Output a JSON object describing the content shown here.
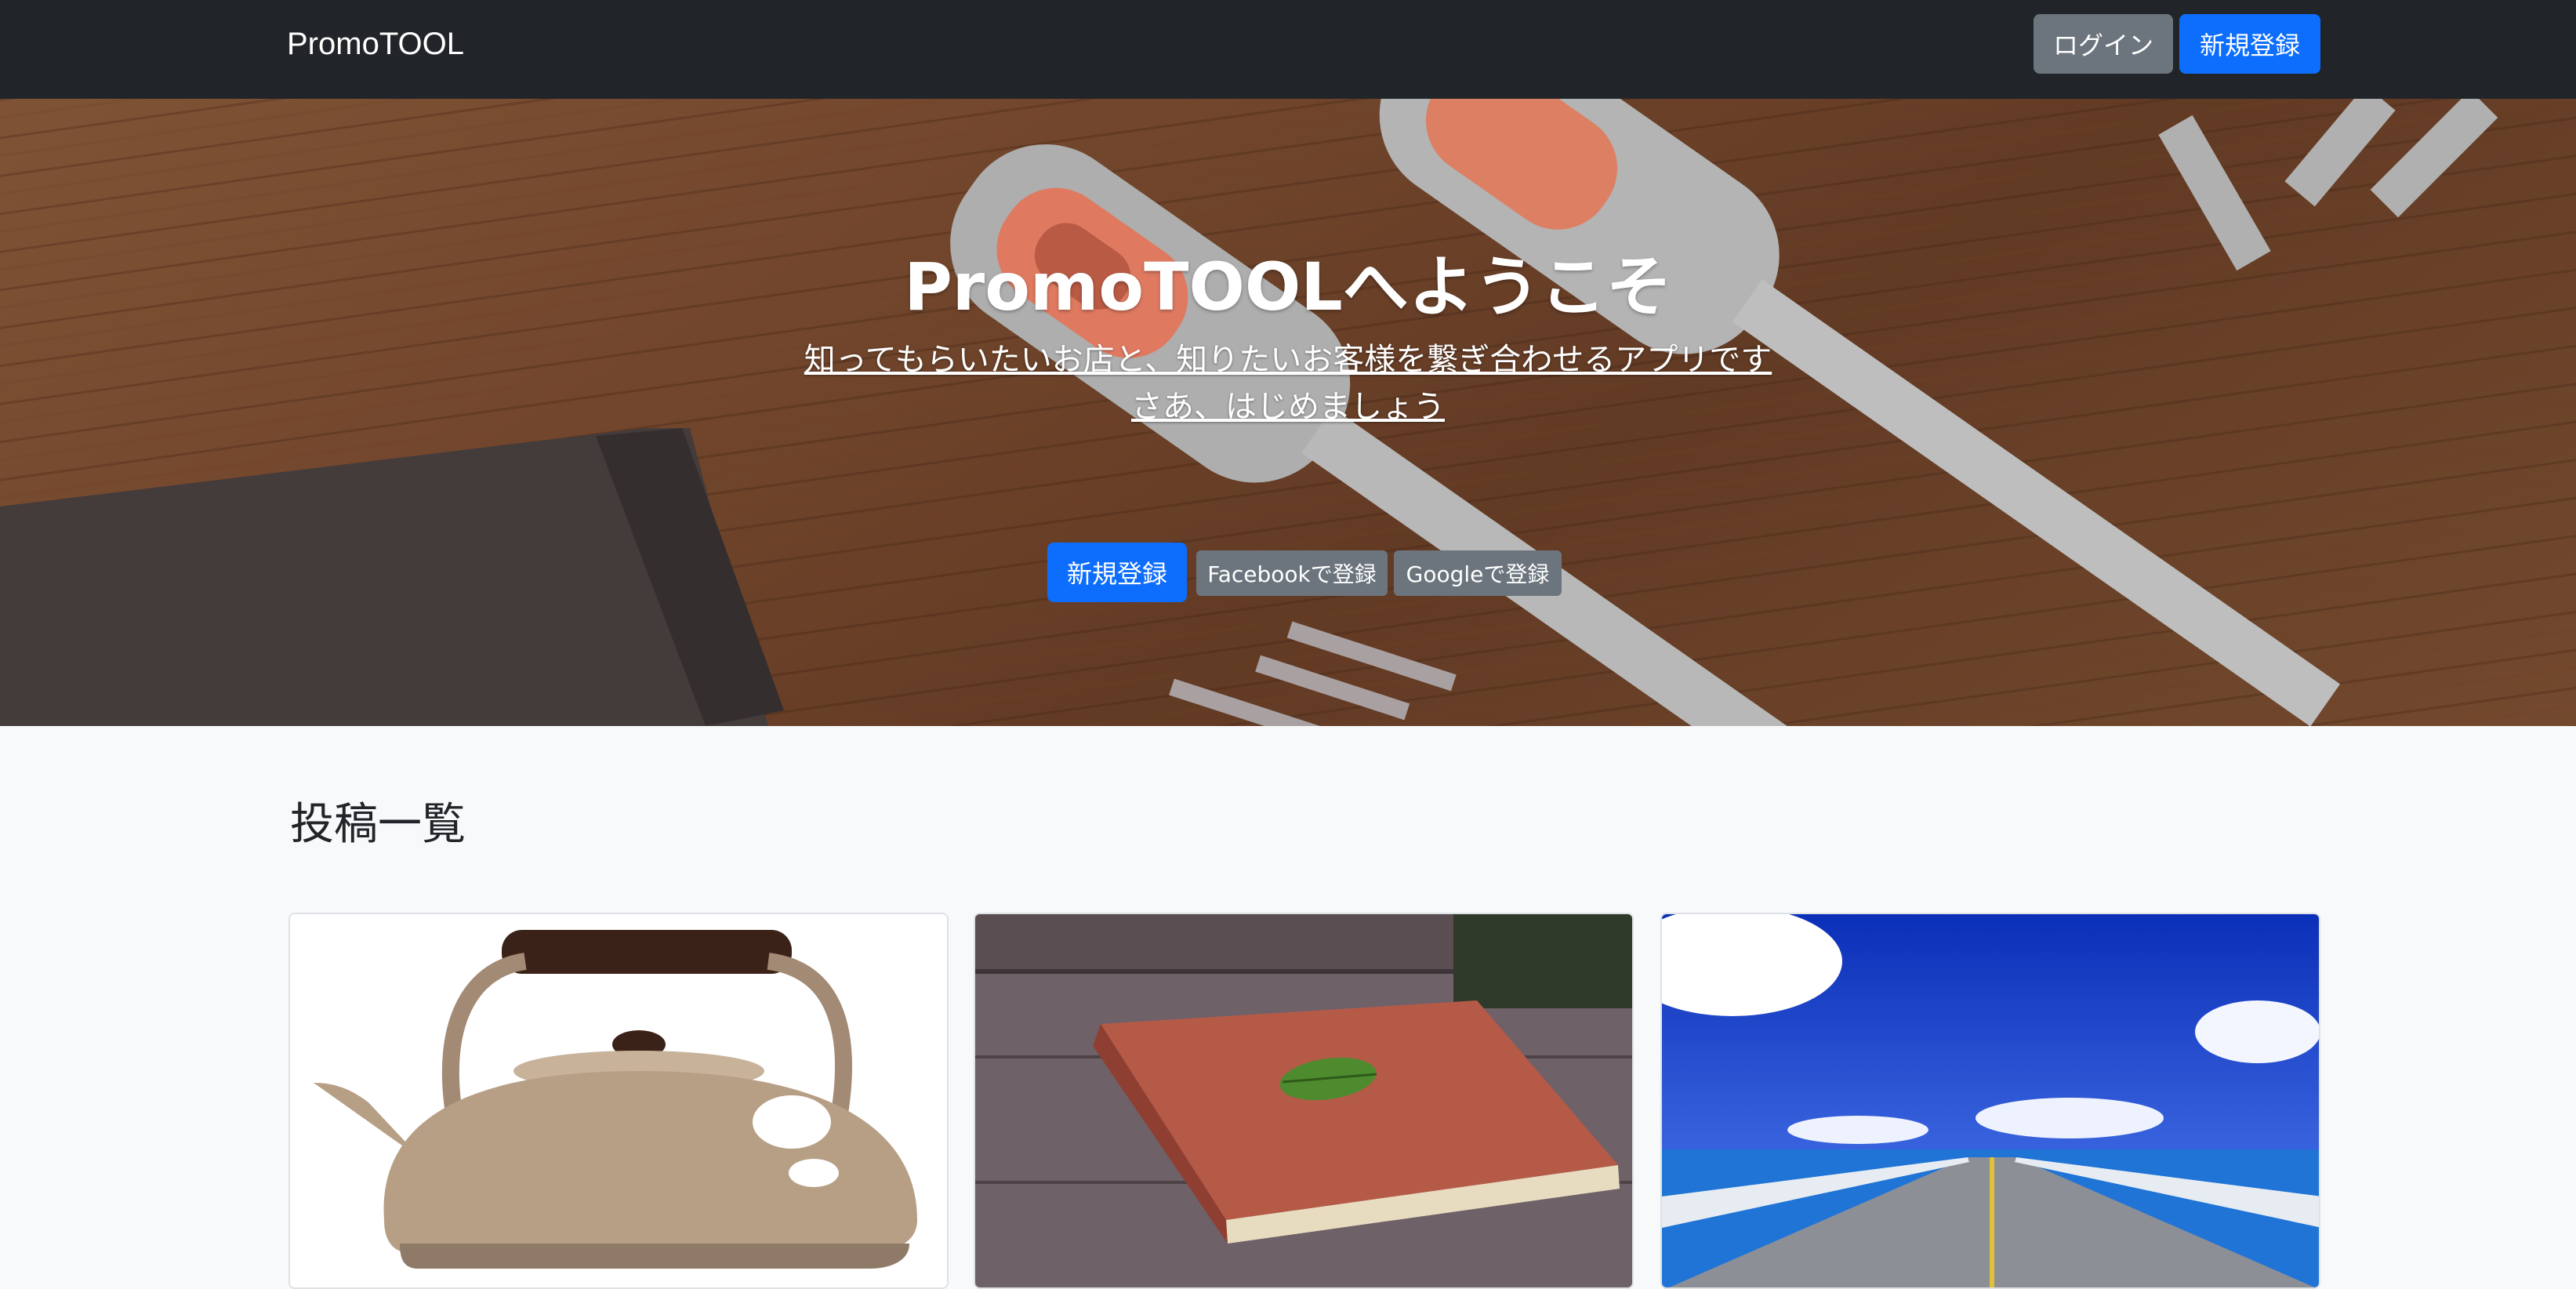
{
  "navbar": {
    "brand": "PromoTOOL",
    "login_label": "ログイン",
    "signup_label": "新規登録"
  },
  "hero": {
    "title": "PromoTOOLへようこそ",
    "subtitle_line1": "知ってもらいたいお店と、知りたいお客様を繋ぎ合わせるアプリです",
    "subtitle_line2": "さあ、はじめましょう",
    "signup_label": "新規登録",
    "facebook_label": "Facebookで登録",
    "google_label": "Googleで登録"
  },
  "posts": {
    "heading": "投稿一覧",
    "cards": [
      {
        "image": "kettle-illustration"
      },
      {
        "image": "red-book-with-leaf"
      },
      {
        "image": "bridge-over-sea"
      }
    ]
  },
  "colors": {
    "navbar_bg": "#212529",
    "primary": "#0d6efd",
    "secondary": "#6c757d",
    "page_bg": "#f8f9fa"
  }
}
